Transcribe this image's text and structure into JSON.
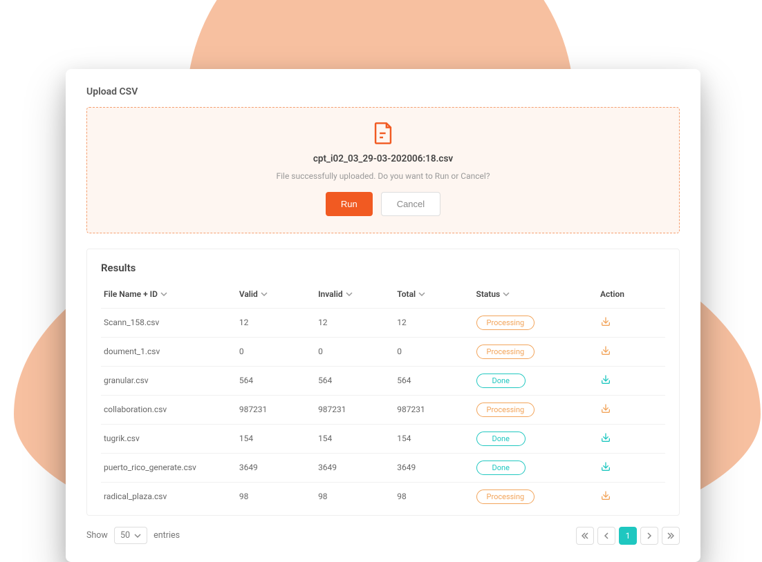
{
  "upload": {
    "section_title": "Upload CSV",
    "filename": "cpt_i02_03_29-03-202006:18.csv",
    "message": "File successfully uploaded. Do you want to Run or Cancel?",
    "run_label": "Run",
    "cancel_label": "Cancel"
  },
  "results": {
    "title": "Results",
    "columns": {
      "filename": "File Name + ID",
      "valid": "Valid",
      "invalid": "Invalid",
      "total": "Total",
      "status": "Status",
      "action": "Action"
    },
    "status_labels": {
      "processing": "Processing",
      "done": "Done"
    },
    "rows": [
      {
        "filename": "Scann_158.csv",
        "valid": "12",
        "invalid": "12",
        "total": "12",
        "status": "processing"
      },
      {
        "filename": "doument_1.csv",
        "valid": "0",
        "invalid": "0",
        "total": "0",
        "status": "processing"
      },
      {
        "filename": "granular.csv",
        "valid": "564",
        "invalid": "564",
        "total": "564",
        "status": "done"
      },
      {
        "filename": "collaboration.csv",
        "valid": "987231",
        "invalid": "987231",
        "total": "987231",
        "status": "processing"
      },
      {
        "filename": "tugrik.csv",
        "valid": "154",
        "invalid": "154",
        "total": "154",
        "status": "done"
      },
      {
        "filename": "puerto_rico_generate.csv",
        "valid": "3649",
        "invalid": "3649",
        "total": "3649",
        "status": "done"
      },
      {
        "filename": "radical_plaza.csv",
        "valid": "98",
        "invalid": "98",
        "total": "98",
        "status": "processing"
      }
    ]
  },
  "footer": {
    "show_label": "Show",
    "entries_label": "entries",
    "page_size": "50",
    "current_page": "1"
  }
}
